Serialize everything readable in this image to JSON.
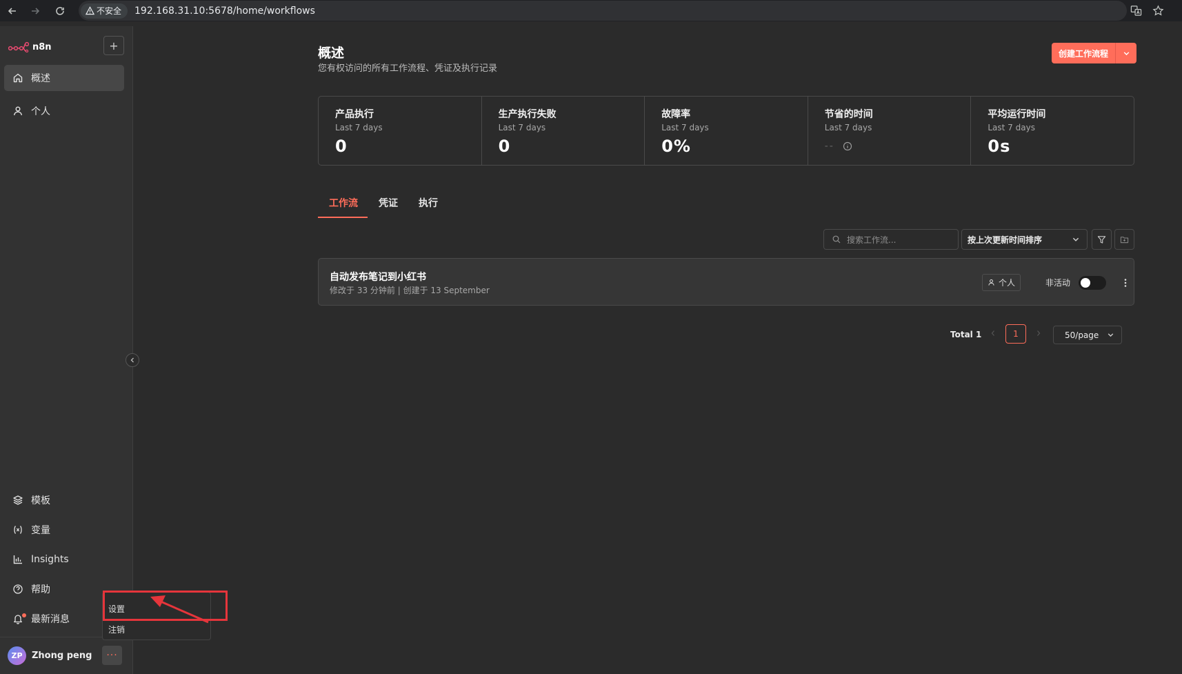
{
  "browser": {
    "security_label": "不安全",
    "url": "192.168.31.10:5678/home/workflows"
  },
  "sidebar": {
    "logo_text": "n8n",
    "add_label": "+",
    "items": [
      {
        "label": "概述",
        "icon": "home-icon"
      },
      {
        "label": "个人",
        "icon": "user-icon"
      }
    ],
    "bottom_items": [
      {
        "label": "模板",
        "icon": "templates-icon"
      },
      {
        "label": "变量",
        "icon": "variables-icon"
      },
      {
        "label": "Insights",
        "icon": "insights-icon"
      },
      {
        "label": "帮助",
        "icon": "help-icon"
      },
      {
        "label": "最新消息",
        "icon": "bell-icon"
      }
    ],
    "user": {
      "initials": "ZP",
      "name": "Zhong peng",
      "more_label": "···"
    }
  },
  "user_menu": {
    "items": [
      "设置",
      "注销"
    ]
  },
  "main": {
    "title": "概述",
    "subtitle": "您有权访问的所有工作流程、凭证及执行记录",
    "create_button": "创建工作流程",
    "stats": [
      {
        "title": "产品执行",
        "period": "Last 7 days",
        "value": "0"
      },
      {
        "title": "生产执行失败",
        "period": "Last 7 days",
        "value": "0"
      },
      {
        "title": "故障率",
        "period": "Last 7 days",
        "value": "0%"
      },
      {
        "title": "节省的时间",
        "period": "Last 7 days",
        "value": "--"
      },
      {
        "title": "平均运行时间",
        "period": "Last 7 days",
        "value": "0s"
      }
    ],
    "tabs": [
      "工作流",
      "凭证",
      "执行"
    ],
    "active_tab": "工作流",
    "search": {
      "placeholder": "搜索工作流..."
    },
    "sort": {
      "selected": "按上次更新时间排序"
    },
    "workflows": [
      {
        "name": "自动发布笔记到小红书",
        "meta": "修改于 33 分钟前 | 创建于 13 September",
        "owner": "个人",
        "status": "非活动",
        "active": false
      }
    ],
    "pagination": {
      "total": "Total 1",
      "current_page": "1",
      "page_size": "50/page"
    }
  },
  "colors": {
    "accent": "#ff6d5a",
    "background": "#2b2b2b",
    "sidebar": "#323232",
    "annotation": "#e6353b"
  }
}
